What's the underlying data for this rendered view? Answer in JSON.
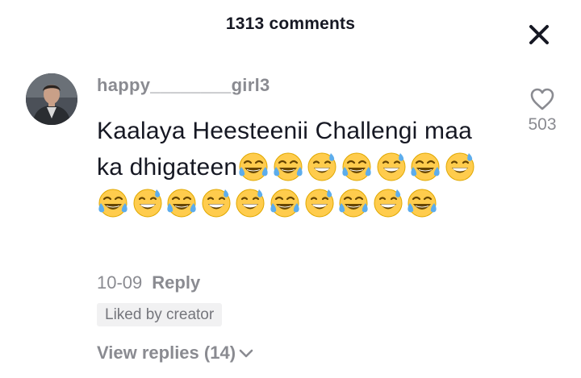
{
  "header": {
    "title": "1313 comments",
    "close_icon": "close-icon"
  },
  "comment": {
    "avatar_icon": "user-avatar",
    "username": "happy________girl3",
    "text": "Kaalaya Heesteenii Challengi maa ka dhigateen",
    "emojis": [
      "tears-of-joy",
      "tears-of-joy",
      "grinning-sweat",
      "tears-of-joy",
      "grinning-sweat",
      "tears-of-joy",
      "grinning-sweat",
      "tears-of-joy",
      "grinning-sweat",
      "tears-of-joy",
      "grinning-sweat",
      "grinning-sweat",
      "tears-of-joy",
      "grinning-sweat",
      "tears-of-joy",
      "grinning-sweat",
      "tears-of-joy"
    ],
    "like_icon": "heart-outline-icon",
    "like_count": "503",
    "date": "10-09",
    "reply_label": "Reply",
    "badge": "Liked by creator",
    "view_replies_label": "View replies (14)",
    "view_replies_icon": "chevron-down-icon"
  },
  "colors": {
    "primary_text": "#161823",
    "secondary_text": "#8a8b91",
    "badge_bg": "#f1f1f2",
    "emoji_yellow": "#ffcc4d",
    "emoji_tear": "#5dadec"
  }
}
